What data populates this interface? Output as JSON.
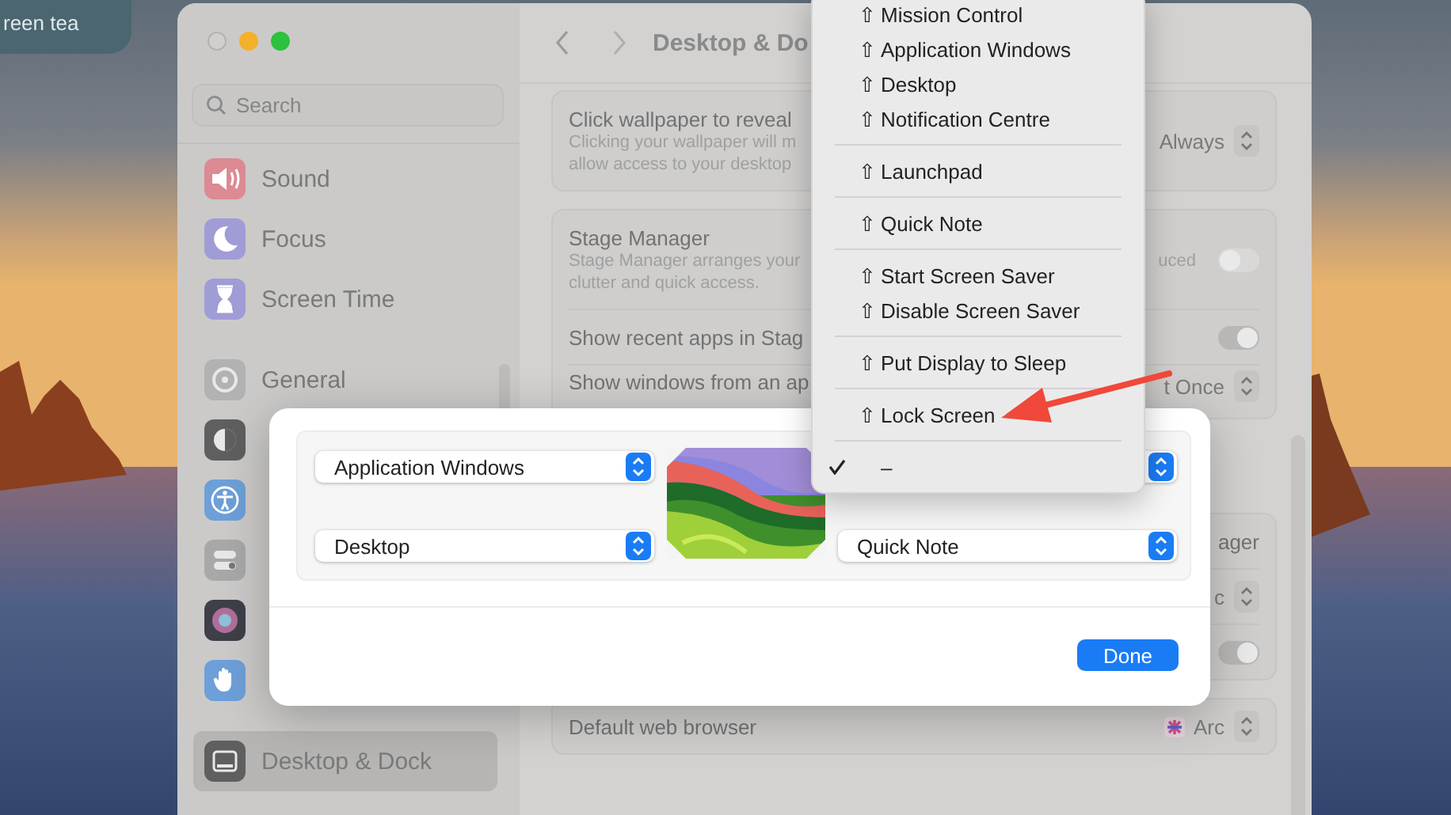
{
  "notification": {
    "text": "reen tea"
  },
  "window": {
    "sidebar": {
      "search": {
        "placeholder": "Search"
      },
      "sections": [
        {
          "items": [
            {
              "label": "Sound",
              "kind": "sound",
              "selected": false
            },
            {
              "label": "Focus",
              "kind": "focus",
              "selected": false
            },
            {
              "label": "Screen Time",
              "kind": "screen-time",
              "selected": false
            }
          ]
        },
        {
          "items": [
            {
              "label": "General",
              "kind": "general",
              "selected": false
            },
            {
              "kind": "appearance",
              "selected": false
            },
            {
              "kind": "accessibility",
              "selected": false
            },
            {
              "kind": "control-centre",
              "selected": false
            },
            {
              "kind": "siri",
              "selected": false
            },
            {
              "kind": "privacy",
              "selected": false
            }
          ]
        },
        {
          "items": [
            {
              "label": "Desktop & Dock",
              "kind": "desktop-dock",
              "selected": true
            }
          ]
        }
      ]
    },
    "header": {
      "title": "Desktop & Do"
    },
    "cards": [
      {
        "rows": [
          {
            "label": "Click wallpaper to reveal",
            "description": [
              "Clicking your wallpaper will m",
              "allow access to your desktop"
            ],
            "control": {
              "kind": "popup",
              "value": "Always"
            }
          }
        ]
      },
      {
        "rows": [
          {
            "label": "Stage Manager",
            "description": [
              "Stage Manager arranges your",
              "clutter and quick access."
            ],
            "description_tail": "uced",
            "control": {
              "kind": "toggle",
              "on": false
            }
          },
          {
            "label": "Show recent apps in Stag",
            "control": {
              "kind": "toggle",
              "on": true
            }
          },
          {
            "label": "Show windows from an ap",
            "control": {
              "kind": "popup",
              "value": "t Once"
            }
          }
        ]
      },
      {
        "rows": [
          {
            "control": {
              "kind": "text",
              "value": "ager"
            }
          },
          {
            "control": {
              "kind": "popup",
              "value": "c"
            }
          },
          {
            "control": {
              "kind": "toggle",
              "on": true
            }
          }
        ]
      },
      {
        "rows": [
          {
            "label": "Default web browser",
            "control": {
              "kind": "app-popup",
              "value": "Arc"
            }
          }
        ]
      }
    ]
  },
  "dialog": {
    "top_left": "Application Windows",
    "bottom_left": "Desktop",
    "bottom_right": "Quick Note",
    "button": "Done"
  },
  "menu": {
    "sections": [
      {
        "items": [
          {
            "modifier": "⇧",
            "label": "Mission Control",
            "checked": false
          },
          {
            "modifier": "⇧",
            "label": "Application Windows",
            "checked": false
          },
          {
            "modifier": "⇧",
            "label": "Desktop",
            "checked": false
          },
          {
            "modifier": "⇧",
            "label": "Notification Centre",
            "checked": false
          }
        ]
      },
      {
        "items": [
          {
            "modifier": "⇧",
            "label": "Launchpad",
            "checked": false
          }
        ]
      },
      {
        "items": [
          {
            "modifier": "⇧",
            "label": "Quick Note",
            "checked": false
          }
        ]
      },
      {
        "items": [
          {
            "modifier": "⇧",
            "label": "Start Screen Saver",
            "checked": false
          },
          {
            "modifier": "⇧",
            "label": "Disable Screen Saver",
            "checked": false
          }
        ]
      },
      {
        "items": [
          {
            "modifier": "⇧",
            "label": "Put Display to Sleep",
            "checked": false
          }
        ]
      },
      {
        "items": [
          {
            "modifier": "⇧",
            "label": "Lock Screen",
            "checked": false
          }
        ]
      },
      {
        "items": [
          {
            "label": "–",
            "checked": true
          }
        ]
      }
    ]
  }
}
